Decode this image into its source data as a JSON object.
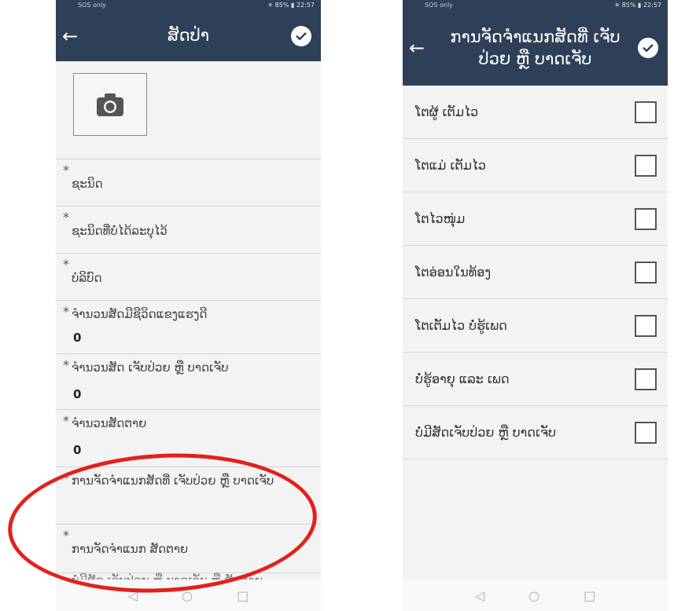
{
  "left": {
    "status": {
      "left": "SOS only",
      "right": "✳ 85% ▮ 22:57"
    },
    "title": "ສັດປ່າ",
    "fields": [
      {
        "label": "ຊະນິດ",
        "value": ""
      },
      {
        "label": "ຊະນິດທີ່ບໍ່ໄດ້ລະບຸໄວ້",
        "value": ""
      },
      {
        "label": "ບໍລິບົດ",
        "value": ""
      },
      {
        "label": "ຈຳນວນສັດມີຊີວິດແຂງແຮງດີ",
        "value": "0"
      },
      {
        "label": "ຈຳນວນສັດ ເຈັບປ່ວຍ ຫຼື ບາດເຈັບ",
        "value": "0"
      },
      {
        "label": "ຈຳນວນສັດຕາຍ",
        "value": "0"
      },
      {
        "label": "ການຈັດຈຳແນກສັດທີ່ ເຈັບປ່ວຍ ຫຼື ບາດເຈັບ",
        "value": ""
      },
      {
        "label": "ການຈັດຈຳແນກ ສັດຕາຍ",
        "value": ""
      }
    ],
    "partial": "ບໍ່ມີສັດ ເຈັບປ່ວຍ ຫຼື ບາດເຈັບ ຫຼື ສັດຕາຍ"
  },
  "right": {
    "status": {
      "left": "SOS only",
      "right": "✳ 85% ▮ 22:57"
    },
    "title": "ການຈັດຈຳແນກສັດທີ່ ເຈັບປ່ວຍ ຫຼື ບາດເຈັບ",
    "options": [
      "ໂຕຜູ້ ເຕັມໄວ",
      "ໂຕແມ່ ເຕັມໄວ",
      "ໂຕໄວໜຸ່ມ",
      "ໂຕອ່ອນໃນທ້ອງ",
      "ໂຕເຕັມໄວ ບໍ່ຮູ້ເພດ",
      "ບໍ່ຮູ້ອາຍຸ ແລະ ເພດ",
      "ບໍ່ມີສັດເຈັບປ່ວຍ ຫຼື ບາດເຈັບ"
    ]
  },
  "nav": {
    "back": "◁",
    "home": "○",
    "recent": "□"
  },
  "colors": {
    "appbar": "#2e4058",
    "highlight": "#e4201c"
  }
}
